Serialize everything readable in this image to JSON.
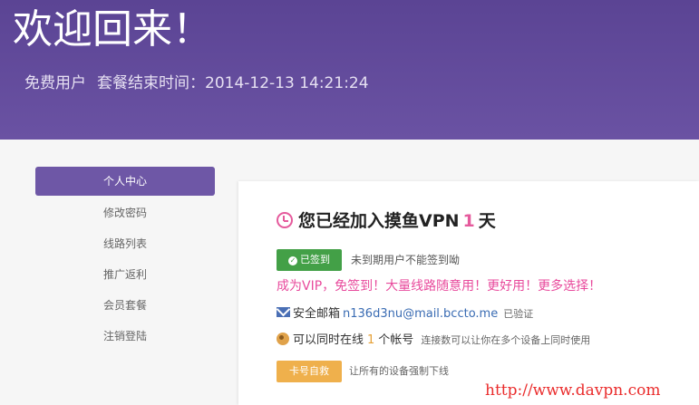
{
  "header": {
    "title": "欢迎回来！",
    "user_type": "免费用户",
    "plan_end_label": "套餐结束时间：",
    "plan_end_time": "2014-12-13 14:21:24"
  },
  "sidebar": {
    "items": [
      {
        "label": "个人中心",
        "active": true
      },
      {
        "label": "修改密码",
        "active": false
      },
      {
        "label": "线路列表",
        "active": false
      },
      {
        "label": "推广返利",
        "active": false
      },
      {
        "label": "会员套餐",
        "active": false
      },
      {
        "label": "注销登陆",
        "active": false
      }
    ]
  },
  "main": {
    "joined_prefix": "您已经加入摸鱼VPN",
    "joined_days": "1",
    "joined_suffix": "天",
    "signin_button": "已签到",
    "signin_note": "未到期用户不能签到呦",
    "vip_promo": "成为VIP，免签到！大量线路随意用！更好用！更多选择！",
    "email_label": "安全邮箱",
    "email_value": "n136d3nu@mail.bccto.me",
    "email_status": "已验证",
    "online_prefix": "可以同时在线",
    "online_count": "1",
    "online_suffix": "个帐号",
    "online_hint": "连接数可以让你在多个设备上同时使用",
    "kick_button": "卡号自救",
    "kick_note": "让所有的设备强制下线"
  },
  "watermark": "http://www.davpn.com",
  "colors": {
    "header_bg": "#5e4697",
    "sidebar_active": "#6e57a6",
    "accent_pink": "#e55a9c",
    "signin_green": "#43a047",
    "kick_orange": "#efb04c",
    "link_blue": "#3a6cb3"
  },
  "icons": {
    "title": "clock-icon",
    "signin": "check-circle-icon",
    "email": "envelope-icon",
    "online": "globe-icon"
  }
}
